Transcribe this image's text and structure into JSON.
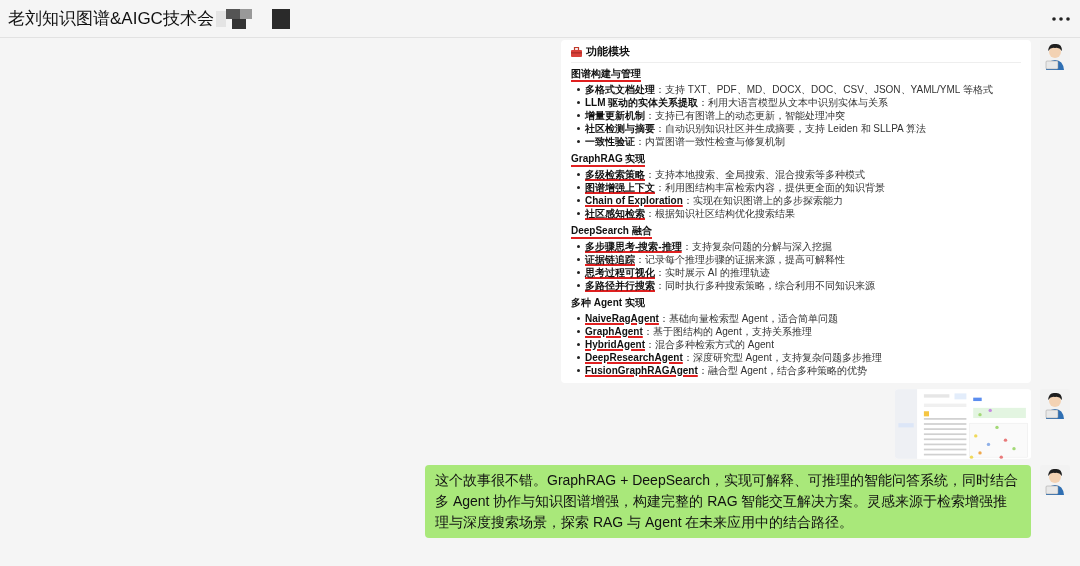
{
  "header": {
    "title": "老刘知识图谱&AIGC技术会"
  },
  "messages": [
    {
      "kind": "document",
      "title": "功能模块",
      "sections": [
        {
          "heading": "图谱构建与管理",
          "underlined": true,
          "items": [
            {
              "term": "多格式文档处理",
              "text": "：支持 TXT、PDF、MD、DOCX、DOC、CSV、JSON、YAML/YML 等格式",
              "underlined": false
            },
            {
              "term": "LLM 驱动的实体关系提取",
              "text": "：利用大语言模型从文本中识别实体与关系",
              "underlined": false
            },
            {
              "term": "增量更新机制",
              "text": "：支持已有图谱上的动态更新，智能处理冲突",
              "underlined": false
            },
            {
              "term": "社区检测与摘要",
              "text": "：自动识别知识社区并生成摘要，支持 Leiden 和 SLLPA 算法",
              "underlined": false
            },
            {
              "term": "一致性验证",
              "text": "：内置图谱一致性检查与修复机制",
              "underlined": false
            }
          ]
        },
        {
          "heading": "GraphRAG 实现",
          "underlined": true,
          "items": [
            {
              "term": "多级检索策略",
              "text": "：支持本地搜索、全局搜索、混合搜索等多种模式",
              "underlined": true
            },
            {
              "term": "图谱增强上下文",
              "text": "：利用图结构丰富检索内容，提供更全面的知识背景",
              "underlined": true
            },
            {
              "term": "Chain of Exploration",
              "text": "：实现在知识图谱上的多步探索能力",
              "underlined": true
            },
            {
              "term": "社区感知检索",
              "text": "：根据知识社区结构优化搜索结果",
              "underlined": true
            }
          ]
        },
        {
          "heading": "DeepSearch 融合",
          "underlined": true,
          "items": [
            {
              "term": "多步骤思考-搜索-推理",
              "text": "：支持复杂问题的分解与深入挖掘",
              "underlined": true
            },
            {
              "term": "证据链追踪",
              "text": "：记录每个推理步骤的证据来源，提高可解释性",
              "underlined": true
            },
            {
              "term": "思考过程可视化",
              "text": "：实时展示 AI 的推理轨迹",
              "underlined": true
            },
            {
              "term": "多路径并行搜索",
              "text": "：同时执行多种搜索策略，综合利用不同知识来源",
              "underlined": true
            }
          ]
        },
        {
          "heading": "多种 Agent 实现",
          "underlined": false,
          "items": [
            {
              "term": "NaiveRagAgent",
              "text": "：基础向量检索型 Agent，适合简单问题",
              "underlined": true
            },
            {
              "term": "GraphAgent",
              "text": "：基于图结构的 Agent，支持关系推理",
              "underlined": true
            },
            {
              "term": "HybridAgent",
              "text": "：混合多种检索方式的 Agent",
              "underlined": true
            },
            {
              "term": "DeepResearchAgent",
              "text": "：深度研究型 Agent，支持复杂问题多步推理",
              "underlined": true
            },
            {
              "term": "FusionGraphRAGAgent",
              "text": "：融合型 Agent，结合多种策略的优势",
              "underlined": true
            }
          ]
        }
      ]
    },
    {
      "kind": "screenshot"
    },
    {
      "kind": "text",
      "text": "这个故事很不错。GraphRAG + DeepSearch，实现可解释、可推理的智能问答系统，同时结合多 Agent 协作与知识图谱增强，构建完整的 RAG 智能交互解决方案。灵感来源于检索增强推理与深度搜索场景，探索 RAG 与 Agent 在未来应用中的结合路径。"
    }
  ]
}
